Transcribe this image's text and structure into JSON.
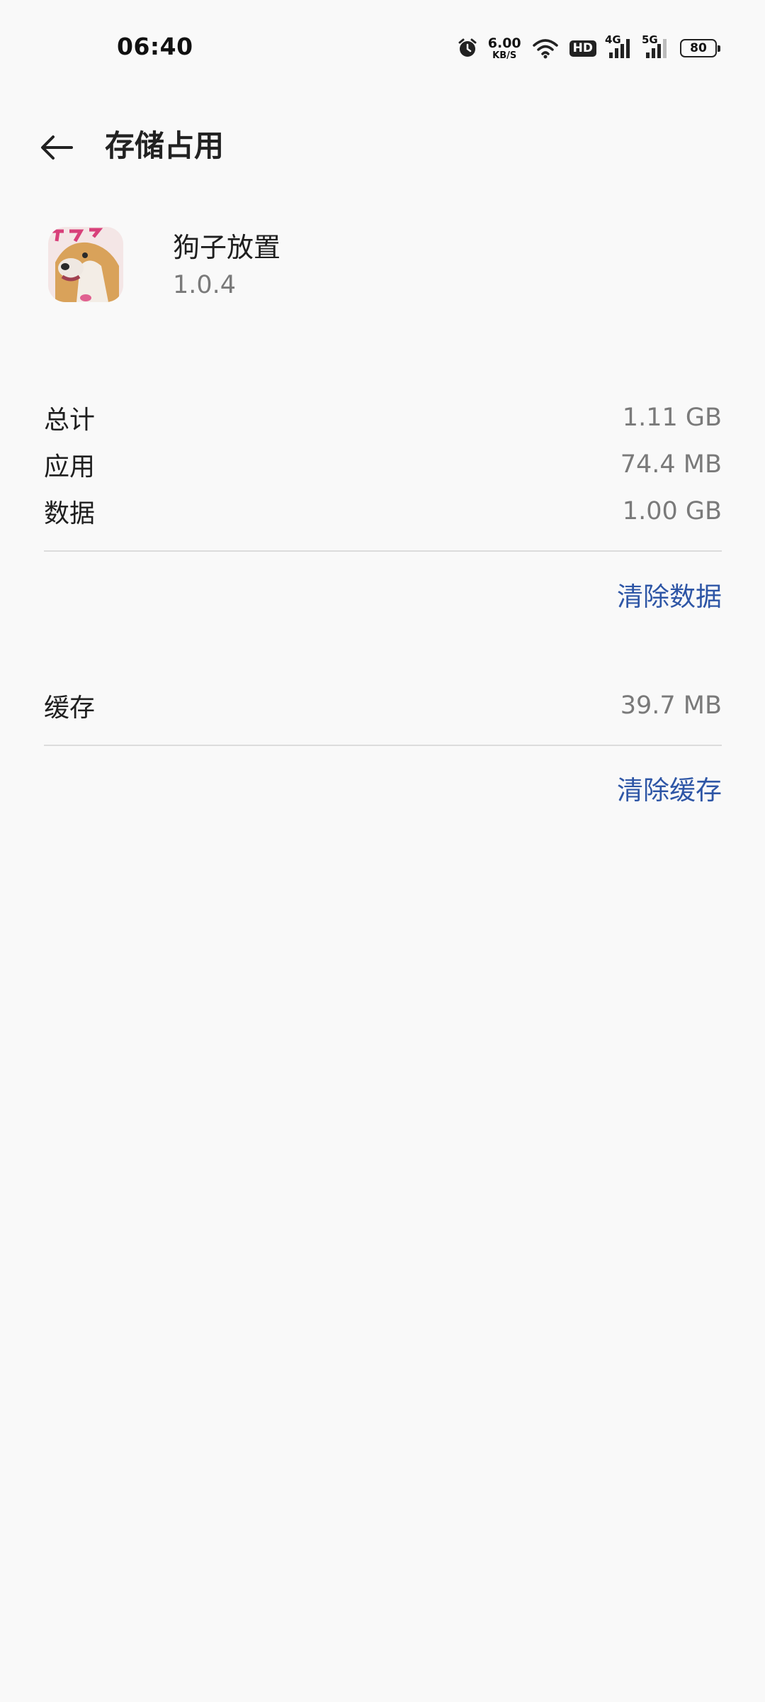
{
  "status_bar": {
    "time": "06:40",
    "net_speed_value": "6.00",
    "net_speed_unit": "KB/S",
    "hd_label": "HD",
    "network_4g": "4G",
    "network_5g": "5G",
    "battery_level": "80"
  },
  "app_bar": {
    "title": "存储占用"
  },
  "app_info": {
    "name": "狗子放置",
    "version": "1.0.4"
  },
  "storage": {
    "rows": [
      {
        "label": "总计",
        "value": "1.11 GB"
      },
      {
        "label": "应用",
        "value": "74.4 MB"
      },
      {
        "label": "数据",
        "value": "1.00 GB"
      }
    ],
    "clear_data_label": "清除数据"
  },
  "cache": {
    "label": "缓存",
    "value": "39.7 MB",
    "clear_cache_label": "清除缓存"
  },
  "colors": {
    "background": "#f9f9f9",
    "accent": "#2e56a6",
    "secondary_text": "#7a7a7a",
    "divider": "#dcdcdc"
  }
}
